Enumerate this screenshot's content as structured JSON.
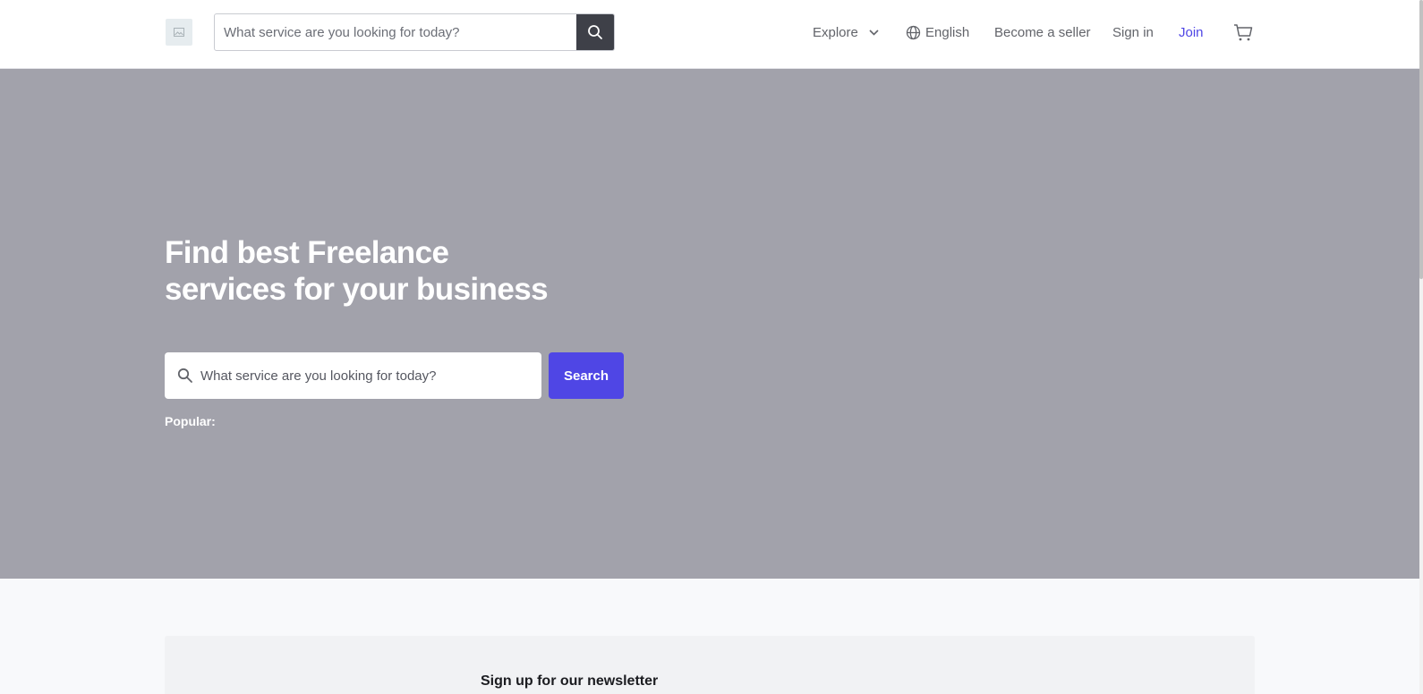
{
  "header": {
    "logo_icon": "image-placeholder-icon",
    "search": {
      "placeholder": "What service are you looking for today?",
      "value": ""
    },
    "search_button_icon": "search-icon",
    "nav": {
      "explore": "Explore",
      "language": "English",
      "become_seller": "Become a seller",
      "sign_in": "Sign in",
      "join": "Join"
    },
    "cart_icon": "cart-icon"
  },
  "hero": {
    "title_line1": "Find best Freelance",
    "title_line2": "services for your business",
    "search": {
      "placeholder": "What service are you looking for today?",
      "value": ""
    },
    "search_button": "Search",
    "popular_label": "Popular:",
    "background": "#a2a2ab"
  },
  "newsletter": {
    "title": "Sign up for our newsletter"
  },
  "colors": {
    "accent": "#4f46e5",
    "dark_button": "#3e4048",
    "nav_text": "#62646a"
  }
}
